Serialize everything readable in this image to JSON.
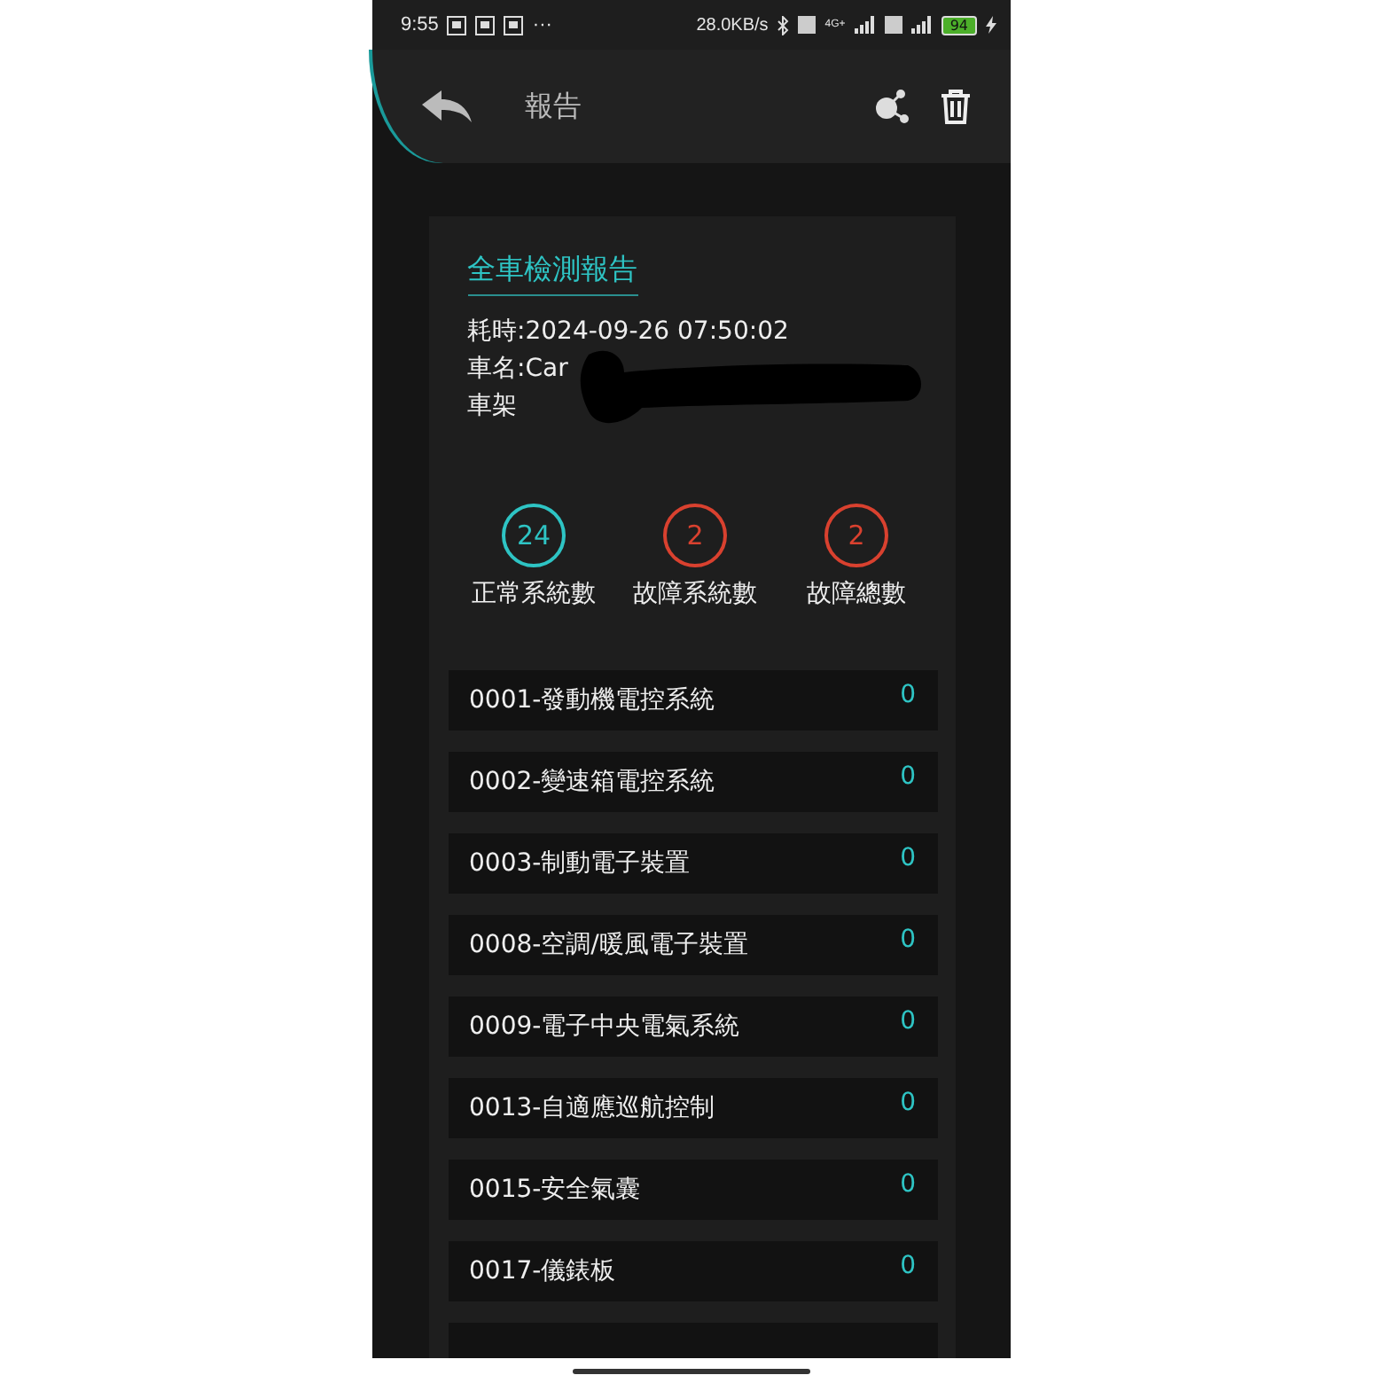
{
  "status_bar": {
    "time": "9:55",
    "more": "···",
    "speed": "28.0KB/s",
    "network": "4G+",
    "battery": "94"
  },
  "app_bar": {
    "title": "報告"
  },
  "report": {
    "title": "全車檢測報告",
    "info": [
      "耗時:2024-09-26 07:50:02",
      "車名:Car",
      "車架"
    ],
    "stats": [
      {
        "value": "24",
        "label": "正常系統數",
        "kind": "ok"
      },
      {
        "value": "2",
        "label": "故障系統數",
        "kind": "fault"
      },
      {
        "value": "2",
        "label": "故障總數",
        "kind": "fault"
      }
    ],
    "systems": [
      {
        "name": "0001-發動機電控系統",
        "count": "0"
      },
      {
        "name": "0002-變速箱電控系統",
        "count": "0"
      },
      {
        "name": "0003-制動電子裝置",
        "count": "0"
      },
      {
        "name": "0008-空調/暖風電子裝置",
        "count": "0"
      },
      {
        "name": "0009-電子中央電氣系統",
        "count": "0"
      },
      {
        "name": "0013-自適應巡航控制",
        "count": "0"
      },
      {
        "name": "0015-安全氣囊",
        "count": "0"
      },
      {
        "name": "0017-儀錶板",
        "count": "0"
      }
    ]
  }
}
